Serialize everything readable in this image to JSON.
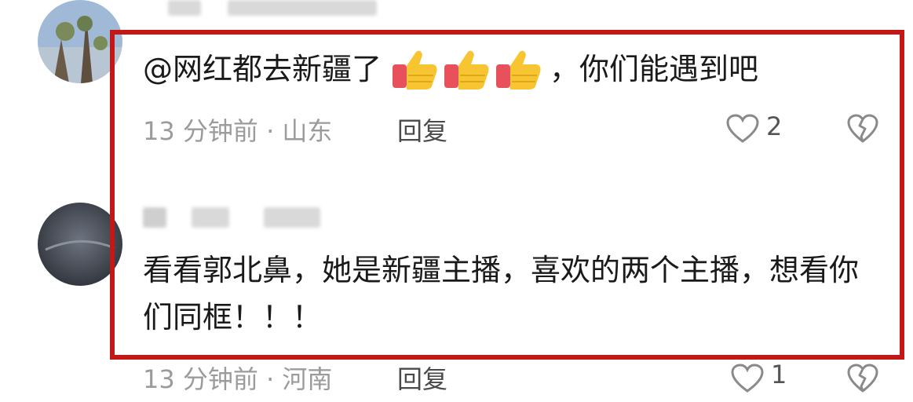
{
  "comments": [
    {
      "text_before": "@网红都去新疆了",
      "emoji": "thumbs-up",
      "emoji_count": 3,
      "text_after": "，你们能遇到吧",
      "time_location": "13 分钟前 · 山东",
      "reply_label": "回复",
      "likes": "2"
    },
    {
      "text": "看看郭北鼻，她是新疆主播，喜欢的两个主播，想看你们同框！！！",
      "time_location": "13 分钟前 · 河南",
      "reply_label": "回复",
      "likes": "1"
    }
  ],
  "colors": {
    "highlight": "#c21818",
    "text": "#1a1a1a",
    "meta": "#9b9b9b"
  },
  "icons": [
    "heart-outline-icon",
    "broken-heart-icon",
    "thumbs-up-emoji"
  ]
}
